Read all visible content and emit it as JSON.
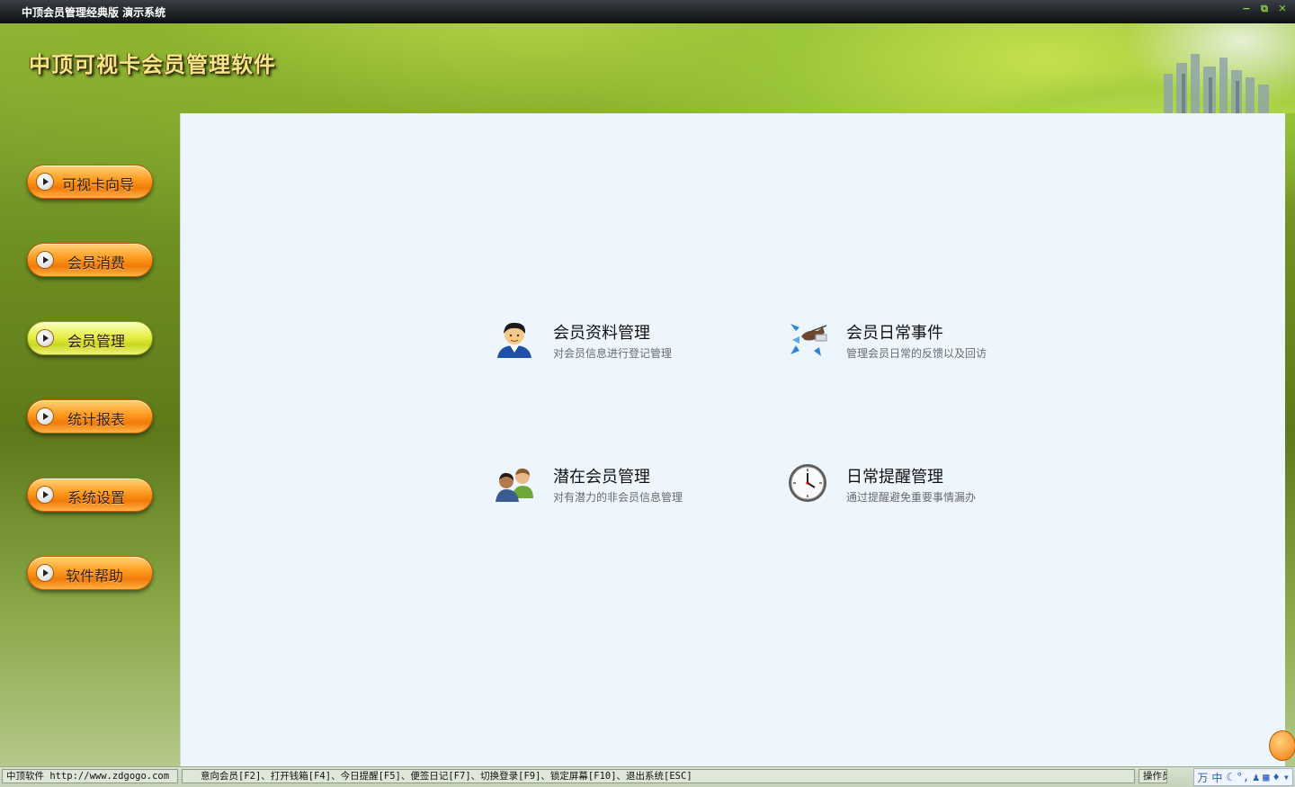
{
  "window": {
    "title": "中顶会员管理经典版 演示系统",
    "buttons": [
      "−",
      "⧉",
      "✕"
    ]
  },
  "header": {
    "app_title": "中顶可视卡会员管理软件"
  },
  "sidebar": {
    "items": [
      {
        "label": "可视卡向导",
        "active": false
      },
      {
        "label": "会员消费",
        "active": false
      },
      {
        "label": "会员管理",
        "active": true
      },
      {
        "label": "统计报表",
        "active": false
      },
      {
        "label": "系统设置",
        "active": false
      },
      {
        "label": "软件帮助",
        "active": false
      }
    ]
  },
  "main": {
    "cards": [
      {
        "title": "会员资料管理",
        "desc": "对会员信息进行登记管理",
        "icon": "member-profile-icon"
      },
      {
        "title": "会员日常事件",
        "desc": "管理会员日常的反馈以及回访",
        "icon": "daily-events-icon"
      },
      {
        "title": "潜在会员管理",
        "desc": "对有潜力的非会员信息管理",
        "icon": "potential-members-icon"
      },
      {
        "title": "日常提醒管理",
        "desc": "通过提醒避免重要事情漏办",
        "icon": "clock-icon"
      }
    ]
  },
  "statusbar": {
    "left": "中顶软件 http://www.zdgogo.com",
    "shortcuts": "意向会员[F2]、打开钱箱[F4]、今日提醒[F5]、便签日记[F7]、切换登录[F9]、锁定屏幕[F10]、退出系统[ESC]",
    "right": "操作员",
    "ime": [
      "万",
      "中",
      "☾",
      "°,",
      "♟",
      "▦",
      "♦",
      "▾"
    ]
  }
}
